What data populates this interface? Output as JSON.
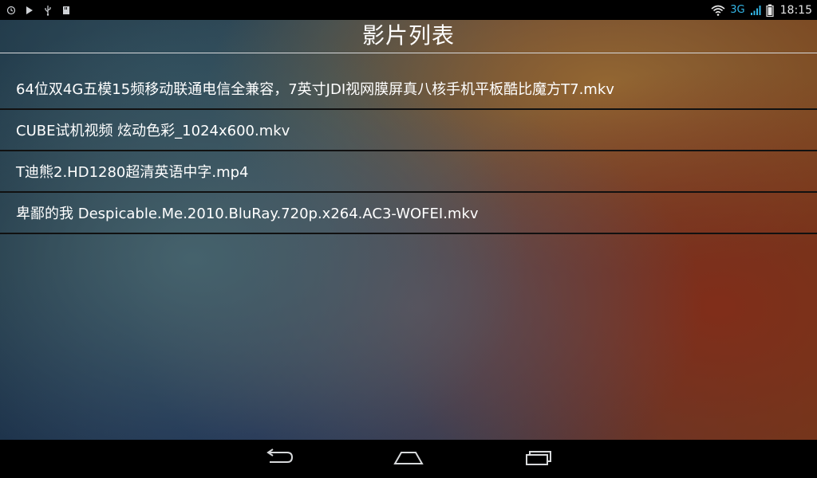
{
  "status_bar": {
    "left_icons": [
      "sync-icon",
      "play-icon",
      "usb-icon",
      "sd-card-icon"
    ],
    "network_type": "3G",
    "time": "18:15",
    "accent_color": "#33b5e5"
  },
  "header": {
    "title": "影片列表"
  },
  "videos": [
    {
      "name": "64位双4G五模15频移动联通电信全兼容，7英寸JDI视网膜屏真八核手机平板酷比魔方T7.mkv"
    },
    {
      "name": "CUBE试机视频 炫动色彩_1024x600.mkv"
    },
    {
      "name": "T迪熊2.HD1280超清英语中字.mp4"
    },
    {
      "name": "卑鄙的我 Despicable.Me.2010.BluRay.720p.x264.AC3-WOFEI.mkv"
    }
  ],
  "nav_bar": {
    "buttons": [
      "back-icon",
      "home-icon",
      "recent-apps-icon"
    ]
  }
}
